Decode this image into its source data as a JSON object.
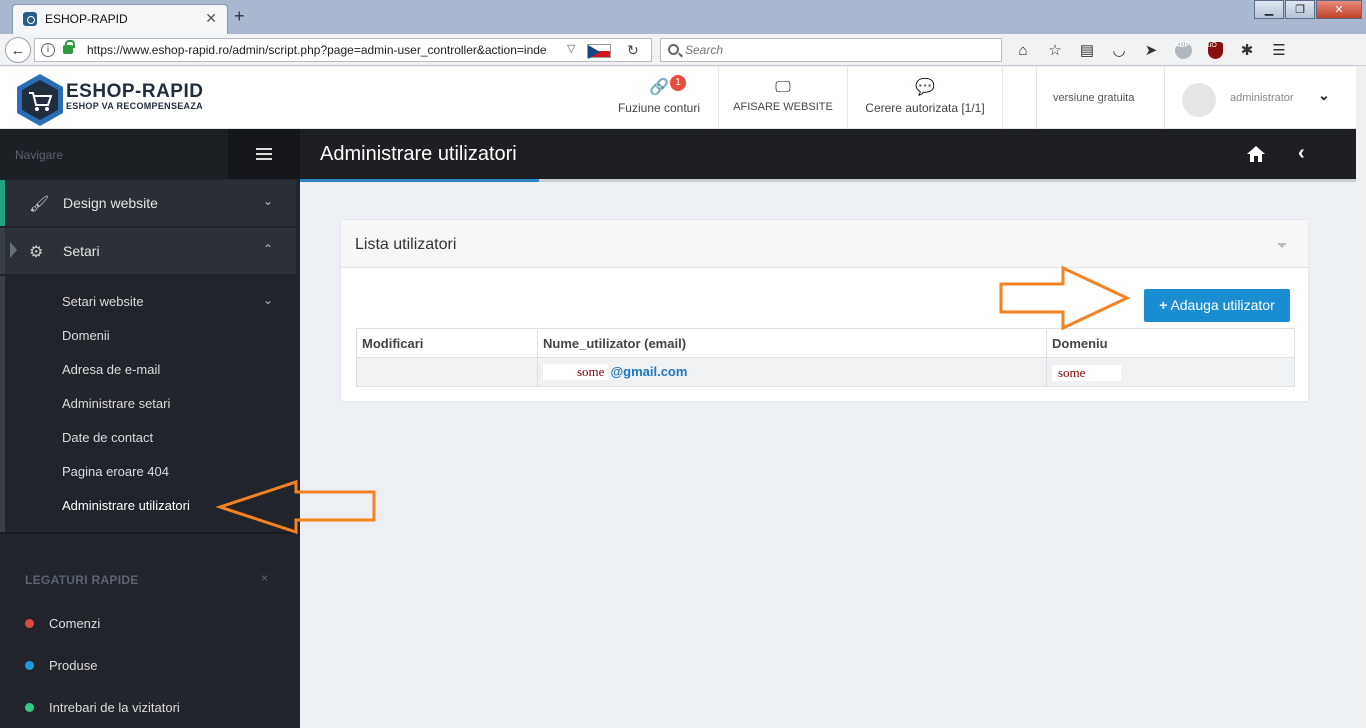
{
  "browser": {
    "tab_title": "ESHOP-RAPID",
    "url": "https://www.eshop-rapid.ro/admin/script.php?page=admin-user_controller&action=inde",
    "search_placeholder": "Search"
  },
  "header": {
    "logo_title": "ESHOP-RAPID",
    "logo_subtitle": "ESHOP VA RECOMPENSEAZA",
    "fuziune_label": "Fuziune conturi",
    "fuziune_badge": "1",
    "afisare_label": "AFISARE WEBSITE",
    "cerere_label": "Cerere autorizata [1/1]",
    "version_label": "versiune gratuita",
    "user_label": "administrator"
  },
  "sidebar": {
    "nav_label": "Navigare",
    "design_label": "Design website",
    "setari_label": "Setari",
    "sub_items": [
      "Setari website",
      "Domenii",
      "Adresa de e-mail",
      "Administrare setari",
      "Date de contact",
      "Pagina eroare 404",
      "Administrare utilizatori"
    ],
    "quick_title": "LEGATURI RAPIDE",
    "quick_close": "×",
    "quick_items": [
      "Comenzi",
      "Produse",
      "Intrebari de la vizitatori"
    ]
  },
  "colors": {
    "dot_comenzi": "#e0473f",
    "dot_produse": "#1b9cde",
    "dot_intrebari": "#2ecc87",
    "accent": "#1b8ed3",
    "annotation": "#f58220"
  },
  "page": {
    "title": "Administrare utilizatori"
  },
  "panel": {
    "title": "Lista utilizatori",
    "add_button": "Adauga utilizator",
    "add_button_icon": "+",
    "columns": [
      "Modificari",
      "Nume_utilizator (email)",
      "Domeniu"
    ],
    "row": {
      "modificari": "",
      "email_name": "some",
      "email_domain": "@gmail.com",
      "domain": "some"
    }
  }
}
